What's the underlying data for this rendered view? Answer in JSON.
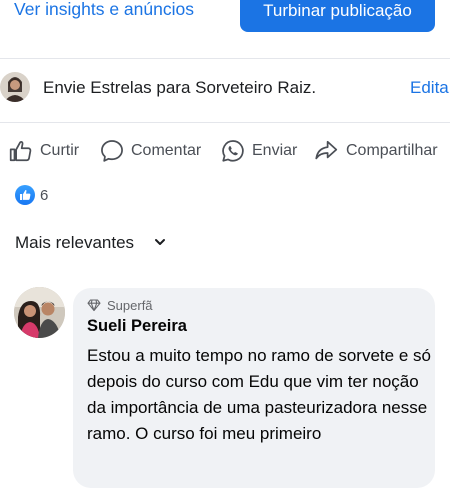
{
  "header": {
    "insights_label": "Ver insights e anúncios",
    "boost_label": "Turbinar publicação"
  },
  "stars": {
    "prompt": "Envie Estrelas para Sorveteiro Raiz.",
    "edit_label": "Edita"
  },
  "actions": [
    {
      "label": "Curtir",
      "icon": "thumbs-up-icon"
    },
    {
      "label": "Comentar",
      "icon": "comment-icon"
    },
    {
      "label": "Enviar",
      "icon": "whatsapp-icon"
    },
    {
      "label": "Compartilhar",
      "icon": "share-icon"
    }
  ],
  "reactions": {
    "count": "6",
    "icon": "like-reaction-icon"
  },
  "sort": {
    "label": "Mais relevantes",
    "icon": "chevron-down-icon"
  },
  "comment": {
    "badge": "Superfã",
    "badge_icon": "diamond-icon",
    "author": "Sueli Pereira",
    "text": "Estou a muito tempo no ramo de sorvete e só depois do curso com Edu que vim ter noção da importância de uma pasteurizadora nesse ramo. O curso foi meu primeiro"
  },
  "colors": {
    "accent": "#1b74e4",
    "secondary_text": "#4b4f56",
    "bubble_bg": "#f0f2f5",
    "divider": "#e4e6eb"
  }
}
